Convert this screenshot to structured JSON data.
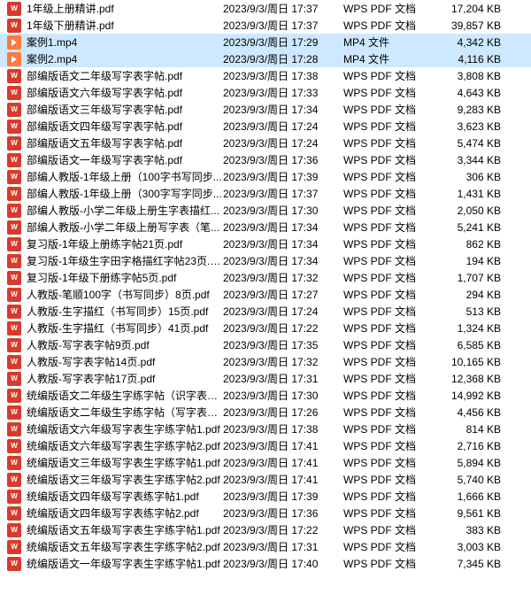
{
  "selectedIndices": [
    2,
    3
  ],
  "files": [
    {
      "icon": "pdf",
      "name": "1年级上册精讲.pdf",
      "date": "2023/9/3/周日 17:37",
      "type": "WPS PDF 文档",
      "size": "17,204 KB"
    },
    {
      "icon": "pdf",
      "name": "1年级下册精讲.pdf",
      "date": "2023/9/3/周日 17:37",
      "type": "WPS PDF 文档",
      "size": "39,857 KB"
    },
    {
      "icon": "mp4",
      "name": "案例1.mp4",
      "date": "2023/9/3/周日 17:29",
      "type": "MP4 文件",
      "size": "4,342 KB"
    },
    {
      "icon": "mp4",
      "name": "案例2.mp4",
      "date": "2023/9/3/周日 17:28",
      "type": "MP4 文件",
      "size": "4,116 KB"
    },
    {
      "icon": "pdf",
      "name": "部编版语文二年级写字表字帖.pdf",
      "date": "2023/9/3/周日 17:38",
      "type": "WPS PDF 文档",
      "size": "3,808 KB"
    },
    {
      "icon": "pdf",
      "name": "部编版语文六年级写字表字帖.pdf",
      "date": "2023/9/3/周日 17:33",
      "type": "WPS PDF 文档",
      "size": "4,643 KB"
    },
    {
      "icon": "pdf",
      "name": "部编版语文三年级写字表字帖.pdf",
      "date": "2023/9/3/周日 17:34",
      "type": "WPS PDF 文档",
      "size": "9,283 KB"
    },
    {
      "icon": "pdf",
      "name": "部编版语文四年级写字表字帖.pdf",
      "date": "2023/9/3/周日 17:24",
      "type": "WPS PDF 文档",
      "size": "3,623 KB"
    },
    {
      "icon": "pdf",
      "name": "部编版语文五年级写字表字帖.pdf",
      "date": "2023/9/3/周日 17:24",
      "type": "WPS PDF 文档",
      "size": "5,474 KB"
    },
    {
      "icon": "pdf",
      "name": "部编版语文一年级写字表字帖.pdf",
      "date": "2023/9/3/周日 17:36",
      "type": "WPS PDF 文档",
      "size": "3,344 KB"
    },
    {
      "icon": "pdf",
      "name": "部编人教版-1年级上册（100字书写同步...",
      "date": "2023/9/3/周日 17:39",
      "type": "WPS PDF 文档",
      "size": "306 KB"
    },
    {
      "icon": "pdf",
      "name": "部编人教版-1年级上册（300字写字同步...",
      "date": "2023/9/3/周日 17:37",
      "type": "WPS PDF 文档",
      "size": "1,431 KB"
    },
    {
      "icon": "pdf",
      "name": "部编人教版-小学二年级上册生字表描红...",
      "date": "2023/9/3/周日 17:30",
      "type": "WPS PDF 文档",
      "size": "2,050 KB"
    },
    {
      "icon": "pdf",
      "name": "部编人教版-小学二年级上册写字表（笔...",
      "date": "2023/9/3/周日 17:34",
      "type": "WPS PDF 文档",
      "size": "5,241 KB"
    },
    {
      "icon": "pdf",
      "name": "复习版-1年级上册练字帖21页.pdf",
      "date": "2023/9/3/周日 17:34",
      "type": "WPS PDF 文档",
      "size": "862 KB"
    },
    {
      "icon": "pdf",
      "name": "复习版-1年级生字田字格描红字帖23页.p...",
      "date": "2023/9/3/周日 17:34",
      "type": "WPS PDF 文档",
      "size": "194 KB"
    },
    {
      "icon": "pdf",
      "name": "复习版-1年级下册练字帖5页.pdf",
      "date": "2023/9/3/周日 17:32",
      "type": "WPS PDF 文档",
      "size": "1,707 KB"
    },
    {
      "icon": "pdf",
      "name": "人教版-笔顺100字（书写同步）8页.pdf",
      "date": "2023/9/3/周日 17:27",
      "type": "WPS PDF 文档",
      "size": "294 KB"
    },
    {
      "icon": "pdf",
      "name": "人教版-生字描红（书写同步）15页.pdf",
      "date": "2023/9/3/周日 17:24",
      "type": "WPS PDF 文档",
      "size": "513 KB"
    },
    {
      "icon": "pdf",
      "name": "人教版-生字描红（书写同步）41页.pdf",
      "date": "2023/9/3/周日 17:22",
      "type": "WPS PDF 文档",
      "size": "1,324 KB"
    },
    {
      "icon": "pdf",
      "name": "人教版-写字表字帖9页.pdf",
      "date": "2023/9/3/周日 17:35",
      "type": "WPS PDF 文档",
      "size": "6,585 KB"
    },
    {
      "icon": "pdf",
      "name": "人教版-写字表字帖14页.pdf",
      "date": "2023/9/3/周日 17:32",
      "type": "WPS PDF 文档",
      "size": "10,165 KB"
    },
    {
      "icon": "pdf",
      "name": "人教版-写字表字帖17页.pdf",
      "date": "2023/9/3/周日 17:31",
      "type": "WPS PDF 文档",
      "size": "12,368 KB"
    },
    {
      "icon": "pdf",
      "name": "统编版语文二年级生字练字帖（识字表）...",
      "date": "2023/9/3/周日 17:30",
      "type": "WPS PDF 文档",
      "size": "14,992 KB"
    },
    {
      "icon": "pdf",
      "name": "统编版语文二年级生字练字帖（写字表）...",
      "date": "2023/9/3/周日 17:26",
      "type": "WPS PDF 文档",
      "size": "4,456 KB"
    },
    {
      "icon": "pdf",
      "name": "统编版语文六年级写字表生字练字帖1.pdf",
      "date": "2023/9/3/周日 17:38",
      "type": "WPS PDF 文档",
      "size": "814 KB"
    },
    {
      "icon": "pdf",
      "name": "统编版语文六年级写字表生字练字帖2.pdf",
      "date": "2023/9/3/周日 17:41",
      "type": "WPS PDF 文档",
      "size": "2,716 KB"
    },
    {
      "icon": "pdf",
      "name": "统编版语文三年级写字表生字练字帖1.pdf",
      "date": "2023/9/3/周日 17:41",
      "type": "WPS PDF 文档",
      "size": "5,894 KB"
    },
    {
      "icon": "pdf",
      "name": "统编版语文三年级写字表生字练字帖2.pdf",
      "date": "2023/9/3/周日 17:41",
      "type": "WPS PDF 文档",
      "size": "5,740 KB"
    },
    {
      "icon": "pdf",
      "name": "统编版语文四年级写字表练字帖1.pdf",
      "date": "2023/9/3/周日 17:39",
      "type": "WPS PDF 文档",
      "size": "1,666 KB"
    },
    {
      "icon": "pdf",
      "name": "统编版语文四年级写字表练字帖2.pdf",
      "date": "2023/9/3/周日 17:36",
      "type": "WPS PDF 文档",
      "size": "9,561 KB"
    },
    {
      "icon": "pdf",
      "name": "统编版语文五年级写字表生字练字帖1.pdf",
      "date": "2023/9/3/周日 17:22",
      "type": "WPS PDF 文档",
      "size": "383 KB"
    },
    {
      "icon": "pdf",
      "name": "统编版语文五年级写字表生字练字帖2.pdf",
      "date": "2023/9/3/周日 17:31",
      "type": "WPS PDF 文档",
      "size": "3,003 KB"
    },
    {
      "icon": "pdf",
      "name": "统编版语文一年级写字表生字练字帖1.pdf",
      "date": "2023/9/3/周日 17:40",
      "type": "WPS PDF 文档",
      "size": "7,345 KB"
    }
  ]
}
